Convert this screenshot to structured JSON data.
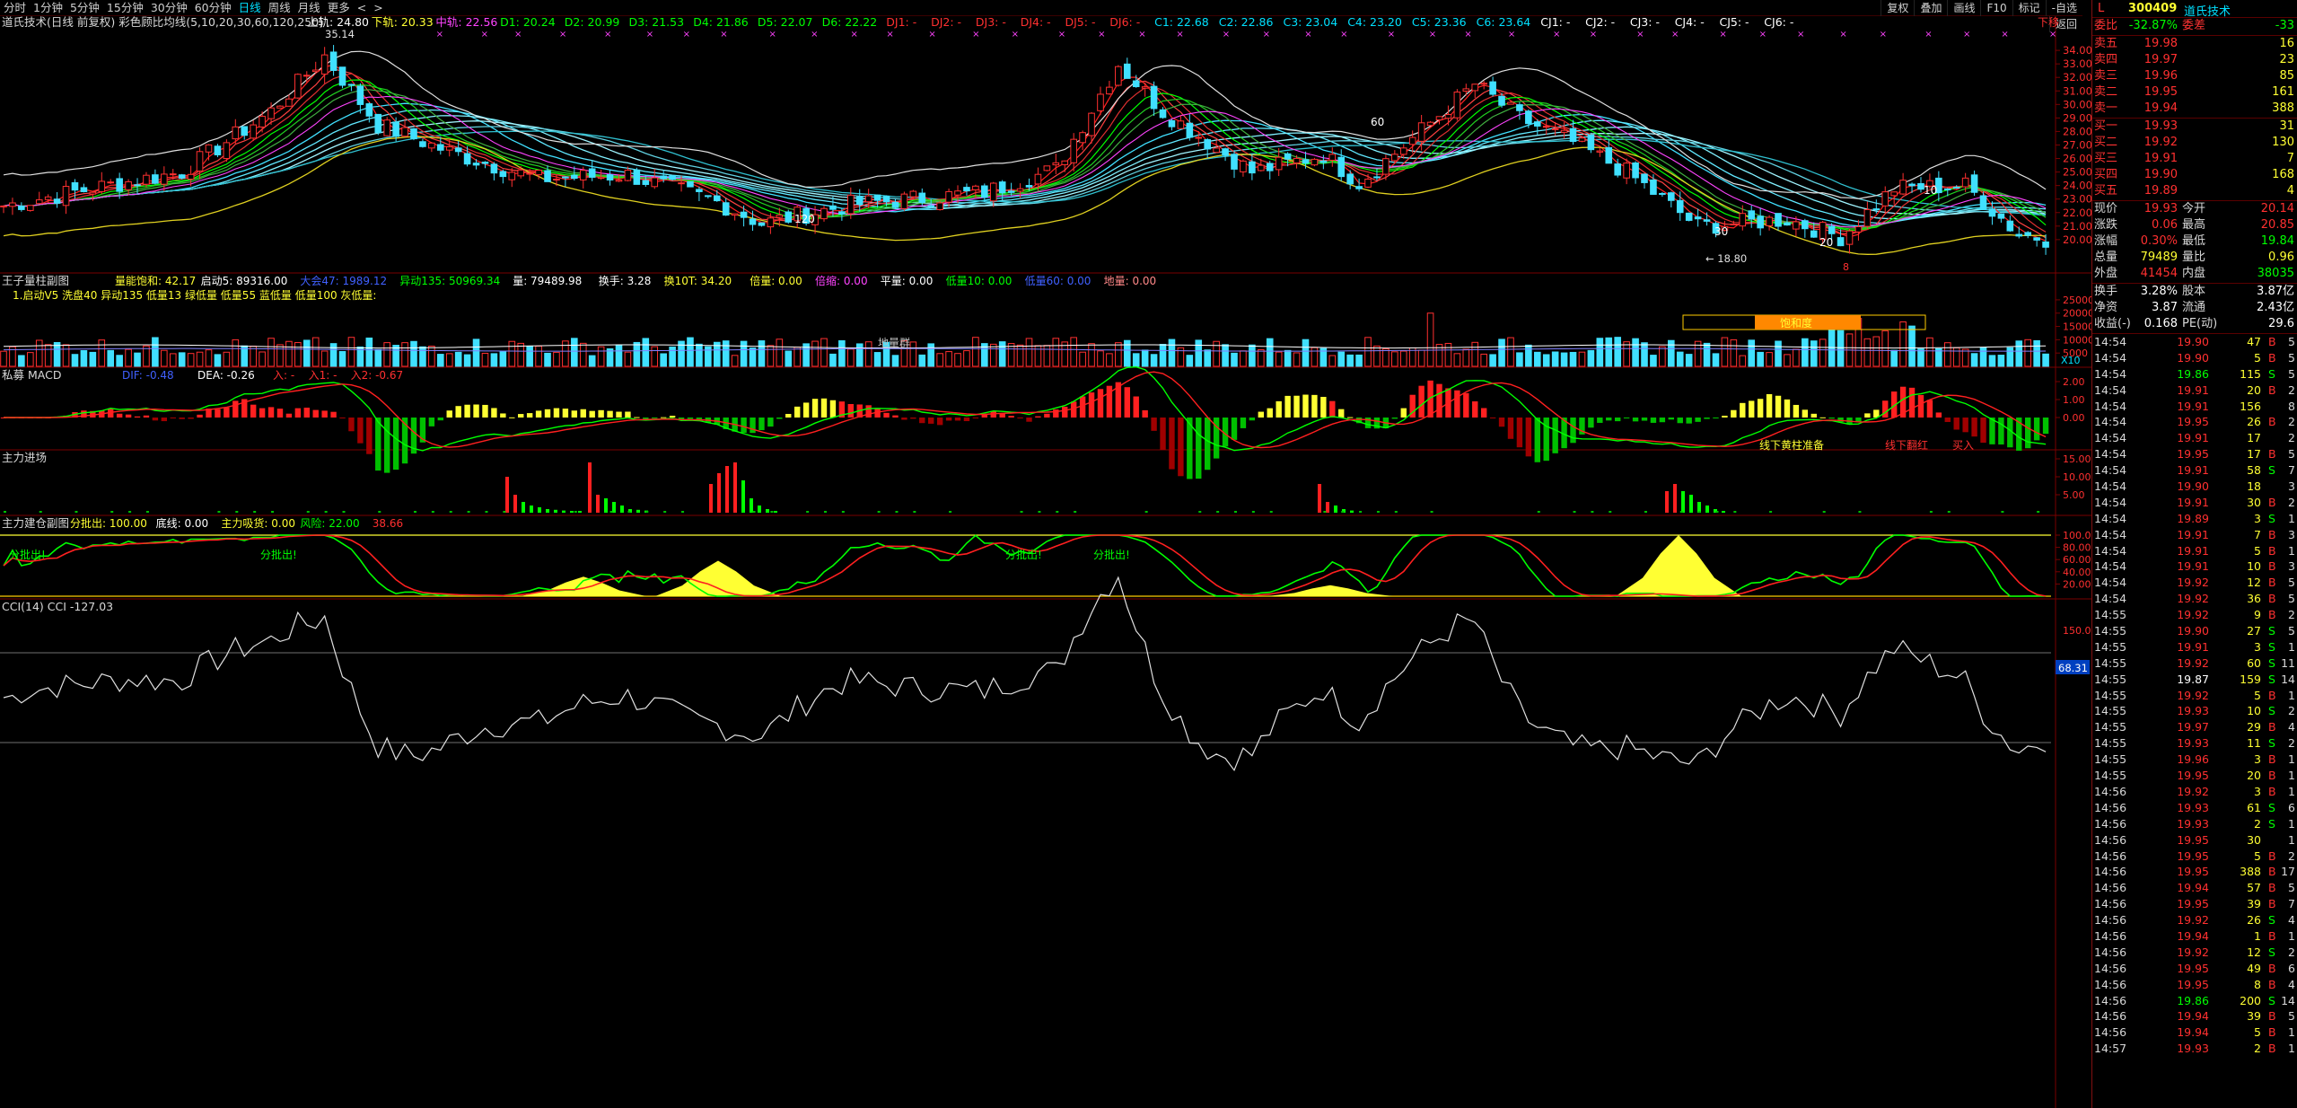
{
  "toolbar": {
    "periods": [
      "分时",
      "1分钟",
      "5分钟",
      "15分钟",
      "30分钟",
      "60分钟",
      "日线",
      "周线",
      "月线",
      "更多",
      "<",
      ">"
    ],
    "active": "日线",
    "right": [
      "复权",
      "叠加",
      "画线",
      "F10",
      "标记",
      "-自选",
      "返回"
    ]
  },
  "main_info": {
    "title": "道氏技术(日线 前复权) 彩色顾比均线(5,10,20,30,60,120,250)",
    "items": [
      {
        "t": "上轨: 24.80",
        "c": "#ffffff"
      },
      {
        "t": "下轨: 20.33",
        "c": "#ffff33"
      },
      {
        "t": "中轨: 22.56",
        "c": "#ff44ff"
      },
      {
        "t": "D1: 20.24",
        "c": "#00ff00"
      },
      {
        "t": "D2: 20.99",
        "c": "#00ff00"
      },
      {
        "t": "D3: 21.53",
        "c": "#00ff00"
      },
      {
        "t": "D4: 21.86",
        "c": "#00ff00"
      },
      {
        "t": "D5: 22.07",
        "c": "#00ff00"
      },
      {
        "t": "D6: 22.22",
        "c": "#00ff00"
      },
      {
        "t": "DJ1: -",
        "c": "#ff3030"
      },
      {
        "t": "DJ2: -",
        "c": "#ff3030"
      },
      {
        "t": "DJ3: -",
        "c": "#ff3030"
      },
      {
        "t": "DJ4: -",
        "c": "#ff3030"
      },
      {
        "t": "DJ5: -",
        "c": "#ff3030"
      },
      {
        "t": "DJ6: -",
        "c": "#ff3030"
      },
      {
        "t": "C1: 22.68",
        "c": "#00e0ff"
      },
      {
        "t": "C2: 22.86",
        "c": "#00e0ff"
      },
      {
        "t": "C3: 23.04",
        "c": "#00e0ff"
      },
      {
        "t": "C4: 23.20",
        "c": "#00e0ff"
      },
      {
        "t": "C5: 23.36",
        "c": "#00e0ff"
      },
      {
        "t": "C6: 23.64",
        "c": "#00e0ff"
      },
      {
        "t": "CJ1: -",
        "c": "#ffffff"
      },
      {
        "t": "CJ2: -",
        "c": "#ffffff"
      },
      {
        "t": "CJ3: -",
        "c": "#ffffff"
      },
      {
        "t": "CJ4: -",
        "c": "#ffffff"
      },
      {
        "t": "CJ5: -",
        "c": "#ffffff"
      },
      {
        "t": "CJ6: -",
        "c": "#ffffff"
      }
    ],
    "top_right": "下移",
    "y_ticks": [
      "34.00",
      "33.00",
      "32.00",
      "31.00",
      "30.00",
      "29.00",
      "28.00",
      "27.00",
      "26.00",
      "25.00",
      "24.00",
      "23.00",
      "22.00",
      "21.00",
      "20.00"
    ],
    "annotations": [
      "35.14",
      "120",
      "60",
      "10",
      "30",
      "20",
      "18.80",
      "8"
    ]
  },
  "vol_pane": {
    "title": "王子量柱副图",
    "items": [
      {
        "t": "量能饱和: 42.17",
        "c": "#ffff33"
      },
      {
        "t": "启动5: 89316.00",
        "c": "#ffffff"
      },
      {
        "t": "大会47: 1989.12",
        "c": "#4060ff"
      },
      {
        "t": "异动135: 50969.34",
        "c": "#00ff00"
      },
      {
        "t": "量: 79489.98",
        "c": "#ffffff"
      },
      {
        "t": "换手: 3.28",
        "c": "#ffffff"
      },
      {
        "t": "换10T: 34.20",
        "c": "#ffff33"
      },
      {
        "t": "倍量: 0.00",
        "c": "#ffff33"
      },
      {
        "t": "倍缩: 0.00",
        "c": "#ff44ff"
      },
      {
        "t": "平量: 0.00",
        "c": "#ffffff"
      },
      {
        "t": "低量10: 0.00",
        "c": "#00ff00"
      },
      {
        "t": "低量60: 0.00",
        "c": "#4060ff"
      },
      {
        "t": "地量: 0.00",
        "c": "#ff8888"
      }
    ],
    "legend": "1.启动V5 洗盘40 异动135 低量13 绿低量 低量55 蓝低量 低量100 灰低量:",
    "y_ticks": [
      "25000",
      "20000",
      "15000",
      "10000",
      "5000"
    ],
    "unit": "X10",
    "sat": "饱和度",
    "ground": "地量群"
  },
  "macd_pane": {
    "title": "私募 MACD",
    "items": [
      {
        "t": "DIF: -0.48",
        "c": "#4060ff"
      },
      {
        "t": "DEA: -0.26",
        "c": "#ffffff"
      },
      {
        "t": "入: -",
        "c": "#ff3030"
      },
      {
        "t": "入1: -",
        "c": "#ff3030"
      },
      {
        "t": "入2: -0.67",
        "c": "#ff3030"
      }
    ],
    "y_ticks": [
      "2.00",
      "1.00",
      "0.00"
    ],
    "notes": [
      "线下黄柱准备",
      "线下翻红",
      "买入"
    ]
  },
  "main_force": {
    "title": "主力进场",
    "y_ticks": [
      "15.00",
      "10.00",
      "5.00"
    ]
  },
  "build_pane": {
    "title": "主力建仓副图",
    "items": [
      {
        "t": "分批出: 100.00",
        "c": "#ffff33"
      },
      {
        "t": "底线: 0.00",
        "c": "#ffffff"
      },
      {
        "t": "主力吸货: 0.00",
        "c": "#ffff33"
      },
      {
        "t": "风险: 22.00",
        "c": "#00ff00"
      },
      {
        "t": "38.66",
        "c": "#ff3030"
      }
    ],
    "y_ticks": [
      "100.00",
      "80.00",
      "60.00",
      "40.00",
      "20.00"
    ],
    "label": "分批出!"
  },
  "cci_pane": {
    "title": "CCI(14) CCI -127.03",
    "y_ticks": [
      "150.00",
      "68.31"
    ]
  },
  "quote": {
    "tag": "L",
    "code": "300409",
    "name": "道氏技术",
    "ratio": [
      {
        "l": "委比",
        "v": "-32.87%",
        "c": "#00ff00"
      },
      {
        "l": "委差",
        "v": "-33",
        "c": "#00ff00"
      }
    ],
    "asks": [
      {
        "l": "卖五",
        "p": "19.98",
        "v": "16"
      },
      {
        "l": "卖四",
        "p": "19.97",
        "v": "23"
      },
      {
        "l": "卖三",
        "p": "19.96",
        "v": "85"
      },
      {
        "l": "卖二",
        "p": "19.95",
        "v": "161"
      },
      {
        "l": "卖一",
        "p": "19.94",
        "v": "388"
      }
    ],
    "bids": [
      {
        "l": "买一",
        "p": "19.93",
        "v": "31"
      },
      {
        "l": "买二",
        "p": "19.92",
        "v": "130"
      },
      {
        "l": "买三",
        "p": "19.91",
        "v": "7"
      },
      {
        "l": "买四",
        "p": "19.90",
        "v": "168"
      },
      {
        "l": "买五",
        "p": "19.89",
        "v": "4"
      }
    ],
    "stats": [
      [
        "现价",
        "19.93",
        "今开",
        "20.14",
        "#ff3030",
        "#ff3030"
      ],
      [
        "涨跌",
        "0.06",
        "最高",
        "20.85",
        "#ff3030",
        "#ff3030"
      ],
      [
        "涨幅",
        "0.30%",
        "最低",
        "19.84",
        "#ff3030",
        "#00ff00"
      ],
      [
        "总量",
        "79489",
        "量比",
        "0.96",
        "#ffff33",
        "#ffff33"
      ],
      [
        "外盘",
        "41454",
        "内盘",
        "38035",
        "#ff3030",
        "#00ff00"
      ]
    ],
    "stats2": [
      [
        "换手",
        "3.28%",
        "股本",
        "3.87亿"
      ],
      [
        "净资",
        "3.87",
        "流通",
        "2.43亿"
      ],
      [
        "收益(-)",
        "0.168",
        "PE(动)",
        "29.6"
      ]
    ]
  },
  "ticks": [
    [
      "14:54",
      "19.90",
      "47",
      "B",
      "5"
    ],
    [
      "14:54",
      "19.90",
      "5",
      "B",
      "5"
    ],
    [
      "14:54",
      "19.86",
      "115",
      "S",
      "5"
    ],
    [
      "14:54",
      "19.91",
      "20",
      "B",
      "2"
    ],
    [
      "14:54",
      "19.91",
      "156",
      "",
      "8"
    ],
    [
      "14:54",
      "19.95",
      "26",
      "B",
      "2"
    ],
    [
      "14:54",
      "19.91",
      "17",
      "",
      "2"
    ],
    [
      "14:54",
      "19.95",
      "17",
      "B",
      "5"
    ],
    [
      "14:54",
      "19.91",
      "58",
      "S",
      "7"
    ],
    [
      "14:54",
      "19.90",
      "18",
      "",
      "3"
    ],
    [
      "14:54",
      "19.91",
      "30",
      "B",
      "2"
    ],
    [
      "14:54",
      "19.89",
      "3",
      "S",
      "1"
    ],
    [
      "14:54",
      "19.91",
      "7",
      "B",
      "3"
    ],
    [
      "14:54",
      "19.91",
      "5",
      "B",
      "1"
    ],
    [
      "14:54",
      "19.91",
      "10",
      "B",
      "3"
    ],
    [
      "14:54",
      "19.92",
      "12",
      "B",
      "5"
    ],
    [
      "14:54",
      "19.92",
      "36",
      "B",
      "5"
    ],
    [
      "14:55",
      "19.92",
      "9",
      "B",
      "2"
    ],
    [
      "14:55",
      "19.90",
      "27",
      "S",
      "5"
    ],
    [
      "14:55",
      "19.91",
      "3",
      "S",
      "1"
    ],
    [
      "14:55",
      "19.92",
      "60",
      "S",
      "11"
    ],
    [
      "14:55",
      "19.87",
      "159",
      "S",
      "14"
    ],
    [
      "14:55",
      "19.92",
      "5",
      "B",
      "1"
    ],
    [
      "14:55",
      "19.93",
      "10",
      "S",
      "2"
    ],
    [
      "14:55",
      "19.97",
      "29",
      "B",
      "4"
    ],
    [
      "14:55",
      "19.93",
      "11",
      "S",
      "2"
    ],
    [
      "14:55",
      "19.96",
      "3",
      "B",
      "1"
    ],
    [
      "14:55",
      "19.95",
      "20",
      "B",
      "1"
    ],
    [
      "14:56",
      "19.92",
      "3",
      "B",
      "1"
    ],
    [
      "14:56",
      "19.93",
      "61",
      "S",
      "6"
    ],
    [
      "14:56",
      "19.93",
      "2",
      "S",
      "1"
    ],
    [
      "14:56",
      "19.95",
      "30",
      "",
      "1"
    ],
    [
      "14:56",
      "19.95",
      "5",
      "B",
      "2"
    ],
    [
      "14:56",
      "19.95",
      "388",
      "B",
      "17"
    ],
    [
      "14:56",
      "19.94",
      "57",
      "B",
      "5"
    ],
    [
      "14:56",
      "19.95",
      "39",
      "B",
      "7"
    ],
    [
      "14:56",
      "19.92",
      "26",
      "S",
      "4"
    ],
    [
      "14:56",
      "19.94",
      "1",
      "B",
      "1"
    ],
    [
      "14:56",
      "19.92",
      "12",
      "S",
      "2"
    ],
    [
      "14:56",
      "19.95",
      "49",
      "B",
      "6"
    ],
    [
      "14:56",
      "19.95",
      "8",
      "B",
      "4"
    ],
    [
      "14:56",
      "19.86",
      "200",
      "S",
      "14"
    ],
    [
      "14:56",
      "19.94",
      "39",
      "B",
      "5"
    ],
    [
      "14:56",
      "19.94",
      "5",
      "B",
      "1"
    ],
    [
      "14:57",
      "19.93",
      "2",
      "B",
      "1"
    ]
  ]
}
